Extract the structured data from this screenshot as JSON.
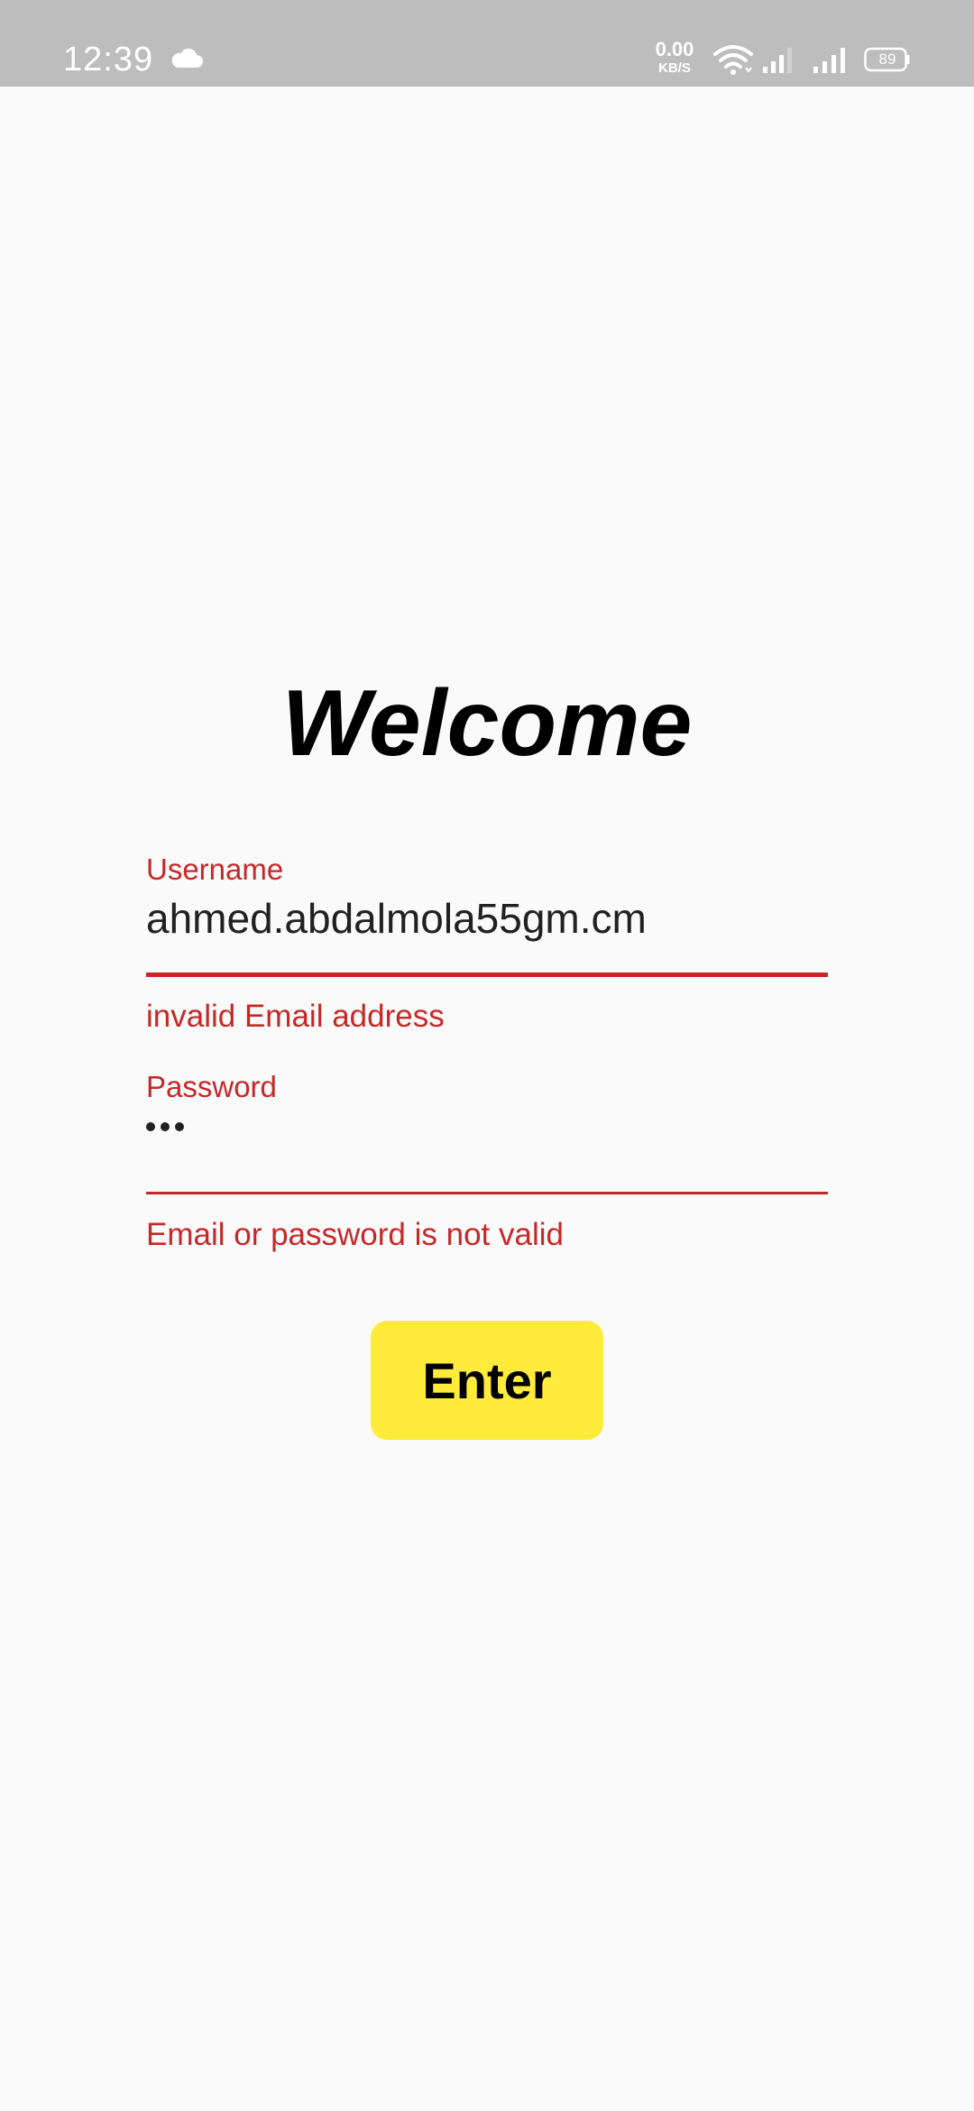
{
  "status_bar": {
    "time": "12:39",
    "net_speed_value": "0.00",
    "net_speed_unit": "KB/S",
    "battery_level": "89",
    "icons": [
      "cloud-icon",
      "wifi-icon",
      "signal-icon",
      "signal-icon",
      "battery-icon"
    ]
  },
  "login": {
    "title": "Welcome",
    "username": {
      "label": "Username",
      "value": "ahmed.abdalmola55gm.cm",
      "error": "invalid Email address"
    },
    "password": {
      "label": "Password",
      "masked_length": 3,
      "error": "Email or password is not valid"
    },
    "submit_label": "Enter"
  },
  "colors": {
    "status_bar_bg": "#bdbdbd",
    "page_bg": "#fafafa",
    "error": "#c62828",
    "button_bg": "#ffeb3b",
    "text": "#212121"
  }
}
